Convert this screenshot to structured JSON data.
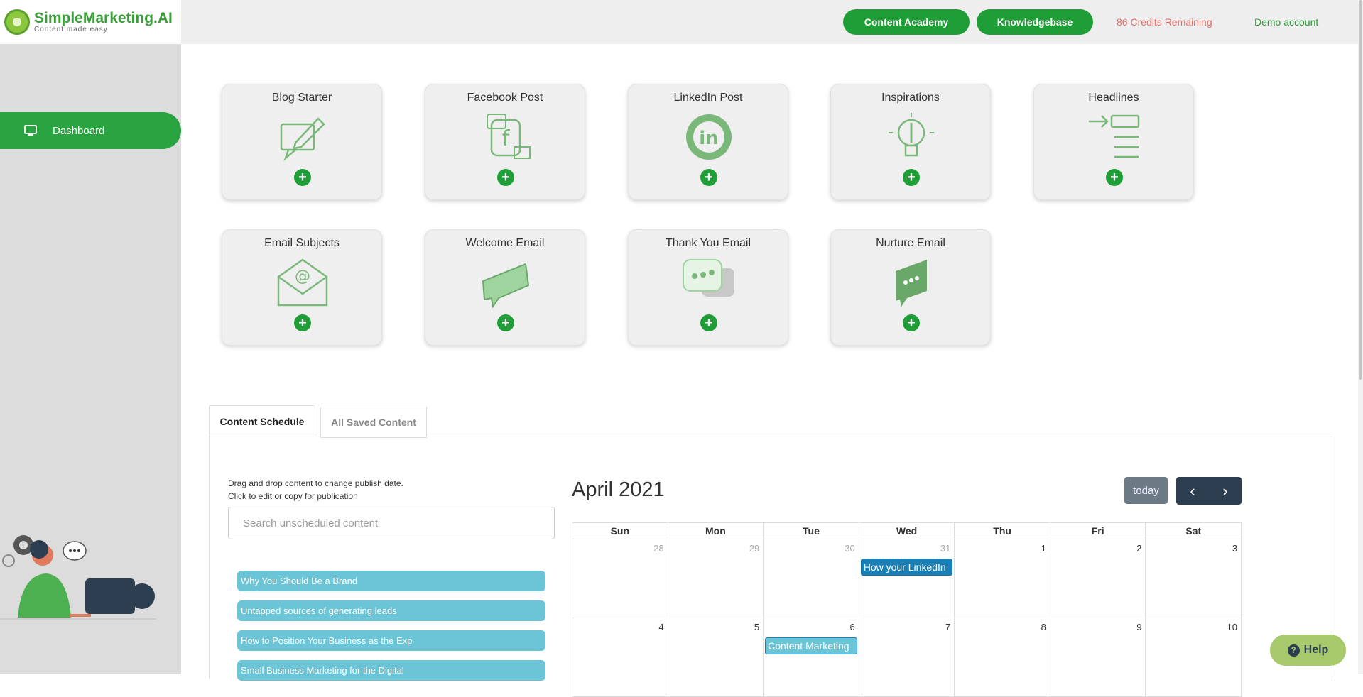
{
  "logo": {
    "title": "SimpleMarketing.AI",
    "subtitle": "Content made easy"
  },
  "sidebar": {
    "dashboard_label": "Dashboard"
  },
  "topbar": {
    "content_academy": "Content Academy",
    "knowledgebase": "Knowledgebase",
    "credits": "86 Credits Remaining",
    "account": "Demo account"
  },
  "cards": [
    {
      "title": "Blog Starter",
      "icon": "blog-icon"
    },
    {
      "title": "Facebook Post",
      "icon": "facebook-icon"
    },
    {
      "title": "LinkedIn Post",
      "icon": "linkedin-icon"
    },
    {
      "title": "Inspirations",
      "icon": "lightbulb-icon"
    },
    {
      "title": "Headlines",
      "icon": "headlines-icon"
    },
    {
      "title": "Email Subjects",
      "icon": "email-envelope-icon"
    },
    {
      "title": "Welcome Email",
      "icon": "chat-bubble-icon"
    },
    {
      "title": "Thank You Email",
      "icon": "chat-bubbles-icon"
    },
    {
      "title": "Nurture Email",
      "icon": "chat-dots-icon"
    }
  ],
  "tabs": {
    "schedule": "Content Schedule",
    "saved": "All Saved Content"
  },
  "schedule": {
    "instruction_1": "Drag and drop content to change publish date.",
    "instruction_2": "Click to edit or copy for publication",
    "search_placeholder": "Search unscheduled content",
    "unscheduled": [
      "Why You Should Be a Brand",
      "Untapped sources of generating leads",
      "How to Position Your Business as the Exp",
      "Small Business Marketing for the Digital"
    ]
  },
  "calendar": {
    "title": "April 2021",
    "today_label": "today",
    "prev_label": "‹",
    "next_label": "›",
    "weekdays": [
      "Sun",
      "Mon",
      "Tue",
      "Wed",
      "Thu",
      "Fri",
      "Sat"
    ],
    "week1": [
      "28",
      "29",
      "30",
      "31",
      "1",
      "2",
      "3"
    ],
    "week2": [
      "4",
      "5",
      "6",
      "7",
      "8",
      "9",
      "10"
    ],
    "events": [
      {
        "day": "31",
        "label": "How your LinkedIn"
      },
      {
        "day": "6",
        "label": "Content Marketing"
      }
    ]
  },
  "help_label": "Help",
  "colors": {
    "brand_green": "#1f9e38",
    "chip_teal": "#6cc5d6",
    "event_blue": "#1a7fb5",
    "credits_red": "#e8706a"
  }
}
